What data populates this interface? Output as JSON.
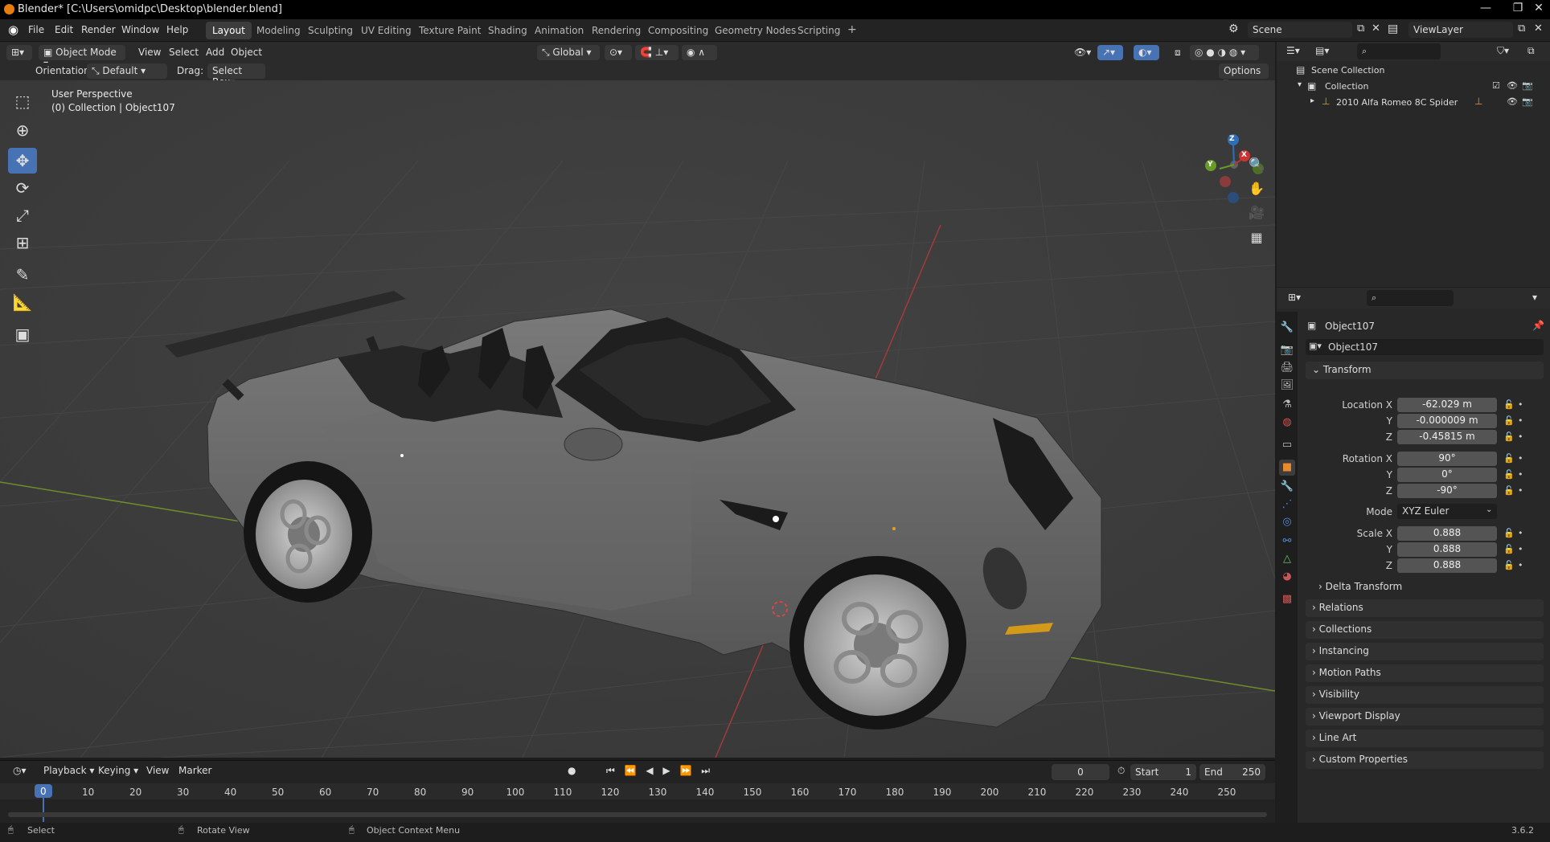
{
  "window": {
    "title": "Blender* [C:\\Users\\omidpc\\Desktop\\blender.blend]",
    "minimize": "—",
    "maximize": "❐",
    "close": "✕"
  },
  "menubar": {
    "items": [
      "File",
      "Edit",
      "Render",
      "Window",
      "Help"
    ]
  },
  "workspaces": {
    "tabs": [
      "Layout",
      "Modeling",
      "Sculpting",
      "UV Editing",
      "Texture Paint",
      "Shading",
      "Animation",
      "Rendering",
      "Compositing",
      "Geometry Nodes",
      "Scripting"
    ],
    "add": "+",
    "active": "Layout"
  },
  "scene": {
    "label": "Scene",
    "viewlayer": "ViewLayer"
  },
  "viewport_header": {
    "mode": "Object Mode",
    "menus": [
      "View",
      "Select",
      "Add",
      "Object"
    ],
    "transform_orientation": "Global",
    "options": "Options"
  },
  "tool_settings": {
    "orientation_label": "Orientation:",
    "orientation_value": "Default",
    "drag_label": "Drag:",
    "drag_value": "Select Box"
  },
  "viewport": {
    "perspective": "User Perspective",
    "collection": "(0) Collection | Object107",
    "gizmo_axes": [
      "Z",
      "Y",
      "X"
    ]
  },
  "outliner": {
    "root": "Scene Collection",
    "collection": "Collection",
    "object": "2010 Alfa Romeo 8C Spider"
  },
  "properties": {
    "object_name": "Object107",
    "object_data_name": "Object107",
    "transform_title": "Transform",
    "location": {
      "label_x": "Location X",
      "label_y": "Y",
      "label_z": "Z",
      "x": "-62.029 m",
      "y": "-0.000009 m",
      "z": "-0.45815 m"
    },
    "rotation": {
      "label_x": "Rotation X",
      "label_y": "Y",
      "label_z": "Z",
      "x": "90°",
      "y": "0°",
      "z": "-90°"
    },
    "mode": {
      "label": "Mode",
      "value": "XYZ Euler"
    },
    "scale": {
      "label_x": "Scale X",
      "label_y": "Y",
      "label_z": "Z",
      "x": "0.888",
      "y": "0.888",
      "z": "0.888"
    },
    "delta": "Delta Transform",
    "panels": [
      "Relations",
      "Collections",
      "Instancing",
      "Motion Paths",
      "Visibility",
      "Viewport Display",
      "Line Art",
      "Custom Properties"
    ]
  },
  "timeline": {
    "menus": [
      "Playback",
      "Keying",
      "View",
      "Marker"
    ],
    "current_frame": "0",
    "start_label": "Start",
    "start": "1",
    "end_label": "End",
    "end": "250",
    "ticks": [
      "0",
      "10",
      "20",
      "30",
      "40",
      "50",
      "60",
      "70",
      "80",
      "90",
      "100",
      "110",
      "120",
      "130",
      "140",
      "150",
      "160",
      "170",
      "180",
      "190",
      "200",
      "210",
      "220",
      "230",
      "240",
      "250"
    ]
  },
  "statusbar": {
    "select": "Select",
    "rotate": "Rotate View",
    "context": "Object Context Menu",
    "version": "3.6.2"
  }
}
